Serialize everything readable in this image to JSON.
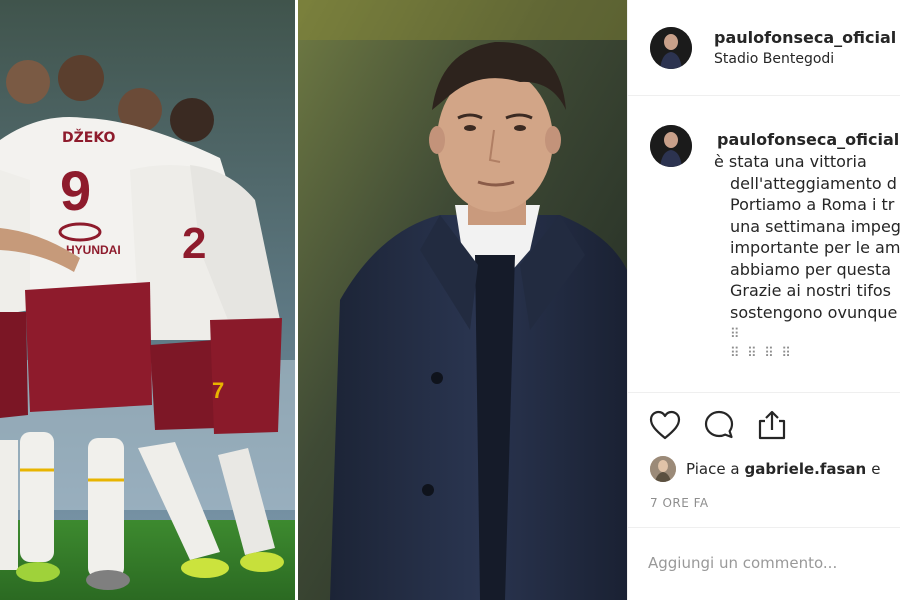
{
  "post": {
    "username": "paulofonseca_oficial",
    "location": "Stadio Bentegodi"
  },
  "caption": {
    "username": "paulofonseca_oficial",
    "lines": [
      "è stata una vittoria",
      "dell'atteggiamento d",
      "Portiamo a Roma i tr",
      "una settimana impeg",
      "importante per le am",
      "abbiamo per questa",
      "Grazie ai nostri tifos",
      "sostengono ovunque"
    ],
    "emoji_line_1": "⠿",
    "emoji_line_2": "⠿ ⠿ ⠿ ⠿"
  },
  "likes": {
    "prefix": "Piace a",
    "user": "gabriele.fasan",
    "suffix": "e"
  },
  "timestamp": "7 ORE FA",
  "comment": {
    "placeholder": "Aggiungi un commento..."
  },
  "photo": {
    "left_player_name": "DŽEKO",
    "left_player_number": "9",
    "second_number": "2",
    "sponsor": "HYUNDAI",
    "sock_number": "7"
  },
  "icons": {
    "like": "heart-icon",
    "comment": "comment-bubble-icon",
    "share": "share-icon"
  },
  "colors": {
    "text": "#262626",
    "muted": "#8e8e8e",
    "divider": "#efefef",
    "roma_red": "#8e1b2c"
  }
}
